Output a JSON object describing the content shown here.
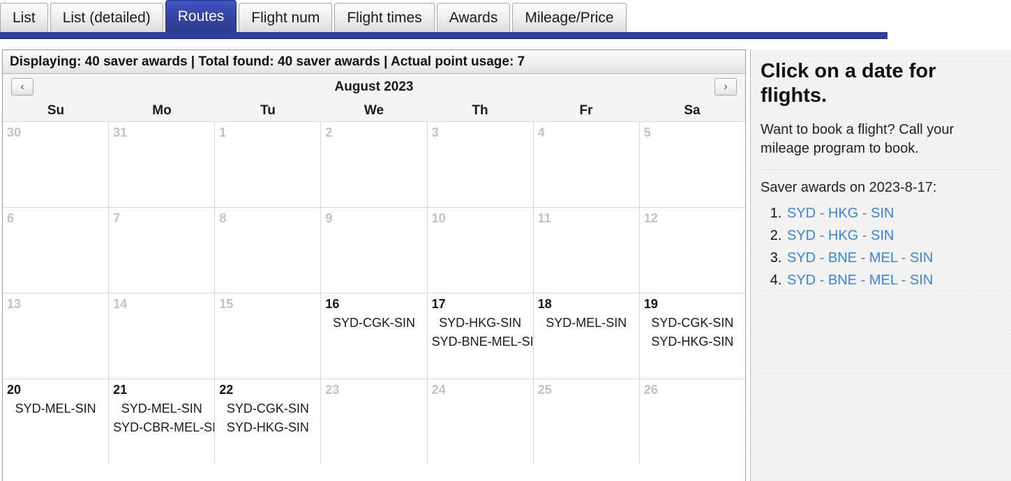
{
  "tabs": [
    {
      "label": "List",
      "active": false
    },
    {
      "label": "List (detailed)",
      "active": false
    },
    {
      "label": "Routes",
      "active": true
    },
    {
      "label": "Flight num",
      "active": false
    },
    {
      "label": "Flight times",
      "active": false
    },
    {
      "label": "Awards",
      "active": false
    },
    {
      "label": "Mileage/Price",
      "active": false
    }
  ],
  "status": {
    "text": "Displaying: 40 saver awards | Total found: 40 saver awards | Actual point usage: 7"
  },
  "calendar": {
    "title": "August 2023",
    "prev_icon": "chevron-left-icon",
    "next_icon": "chevron-right-icon",
    "prev_glyph": "‹",
    "next_glyph": "›",
    "day_headers": [
      "Su",
      "Mo",
      "Tu",
      "We",
      "Th",
      "Fr",
      "Sa"
    ],
    "weeks": [
      [
        {
          "day": "30",
          "muted": true,
          "routes": []
        },
        {
          "day": "31",
          "muted": true,
          "routes": []
        },
        {
          "day": "1",
          "muted": true,
          "routes": []
        },
        {
          "day": "2",
          "muted": true,
          "routes": []
        },
        {
          "day": "3",
          "muted": true,
          "routes": []
        },
        {
          "day": "4",
          "muted": true,
          "routes": []
        },
        {
          "day": "5",
          "muted": true,
          "routes": []
        }
      ],
      [
        {
          "day": "6",
          "muted": true,
          "routes": []
        },
        {
          "day": "7",
          "muted": true,
          "routes": []
        },
        {
          "day": "8",
          "muted": true,
          "routes": []
        },
        {
          "day": "9",
          "muted": true,
          "routes": []
        },
        {
          "day": "10",
          "muted": true,
          "routes": []
        },
        {
          "day": "11",
          "muted": true,
          "routes": []
        },
        {
          "day": "12",
          "muted": true,
          "routes": []
        }
      ],
      [
        {
          "day": "13",
          "muted": true,
          "routes": []
        },
        {
          "day": "14",
          "muted": true,
          "routes": []
        },
        {
          "day": "15",
          "muted": true,
          "routes": []
        },
        {
          "day": "16",
          "muted": false,
          "routes": [
            "SYD-CGK-SIN"
          ]
        },
        {
          "day": "17",
          "muted": false,
          "routes": [
            "SYD-HKG-SIN",
            "SYD-BNE-MEL-SIN"
          ]
        },
        {
          "day": "18",
          "muted": false,
          "routes": [
            "SYD-MEL-SIN"
          ]
        },
        {
          "day": "19",
          "muted": false,
          "routes": [
            "SYD-CGK-SIN",
            "SYD-HKG-SIN"
          ]
        }
      ],
      [
        {
          "day": "20",
          "muted": false,
          "routes": [
            "SYD-MEL-SIN"
          ]
        },
        {
          "day": "21",
          "muted": false,
          "routes": [
            "SYD-MEL-SIN",
            "SYD-CBR-MEL-SIN"
          ]
        },
        {
          "day": "22",
          "muted": false,
          "routes": [
            "SYD-CGK-SIN",
            "SYD-HKG-SIN"
          ]
        },
        {
          "day": "23",
          "muted": true,
          "routes": []
        },
        {
          "day": "24",
          "muted": true,
          "routes": []
        },
        {
          "day": "25",
          "muted": true,
          "routes": []
        },
        {
          "day": "26",
          "muted": true,
          "routes": []
        }
      ]
    ]
  },
  "sidebar": {
    "title": "Click on a date for flights.",
    "subtitle": "Want to book a flight? Call your mileage program to book.",
    "awards_label": "Saver awards on 2023-8-17:",
    "awards": [
      "SYD - HKG - SIN",
      "SYD - HKG - SIN",
      "SYD - BNE - MEL - SIN",
      "SYD - BNE - MEL - SIN"
    ]
  },
  "colors": {
    "active_tab": "#2c3992",
    "underline": "#2e3f9e",
    "link": "#3a85d8",
    "muted_day": "#c2c2c2"
  }
}
